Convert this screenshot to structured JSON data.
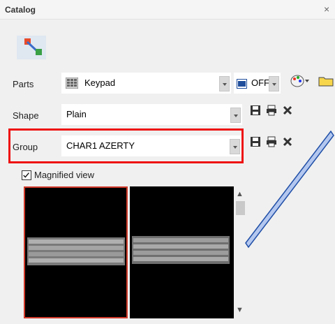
{
  "window": {
    "title": "Catalog",
    "close_glyph": "×"
  },
  "fields": {
    "parts": {
      "label": "Parts",
      "value": "Keypad",
      "icon": "keypad-icon"
    },
    "shape": {
      "label": "Shape",
      "value": "Plain"
    },
    "group": {
      "label": "Group",
      "value": "CHAR1 AZERTY"
    }
  },
  "toggle": {
    "value": "OFF",
    "icon": "off-icon"
  },
  "magnified_view": {
    "label": "Magnified view",
    "checked": true
  },
  "previews": [
    {
      "name": "azerty-keyboard-preview",
      "selected": true
    },
    {
      "name": "qwerty-keyboard-preview",
      "selected": false
    }
  ],
  "colors": {
    "highlight": "#e11111",
    "selected_border": "#d03a2a",
    "preview_bg": "#000000"
  }
}
